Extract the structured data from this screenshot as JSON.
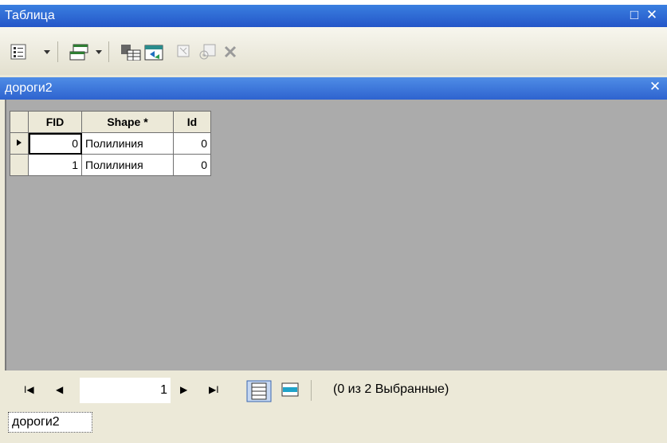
{
  "window": {
    "title": "Таблица",
    "restore_glyph": "□",
    "close_glyph": "✕"
  },
  "toolbar": {
    "items": [
      "table-options-icon",
      "related-tables-icon",
      "select-by-attributes-icon",
      "switch-selection-icon",
      "clear-selection-icon",
      "zoom-to-selected-icon",
      "delete-selected-icon"
    ]
  },
  "tab_panel": {
    "title": "дороги2",
    "close_glyph": "✕"
  },
  "grid": {
    "columns": [
      "FID",
      "Shape *",
      "Id"
    ],
    "rows": [
      {
        "fid": "0",
        "shape": "Полилиния",
        "id": "0"
      },
      {
        "fid": "1",
        "shape": "Полилиния",
        "id": "0"
      }
    ]
  },
  "nav": {
    "first": "I◀",
    "prev": "◀",
    "record": "1",
    "next": "▶",
    "last": "▶I",
    "status": "(0 из 2 Выбранные)"
  },
  "bottom_tab": {
    "label": "дороги2"
  },
  "colors": {
    "title_blue": "#2456c8",
    "grid_bg": "#ababab"
  }
}
